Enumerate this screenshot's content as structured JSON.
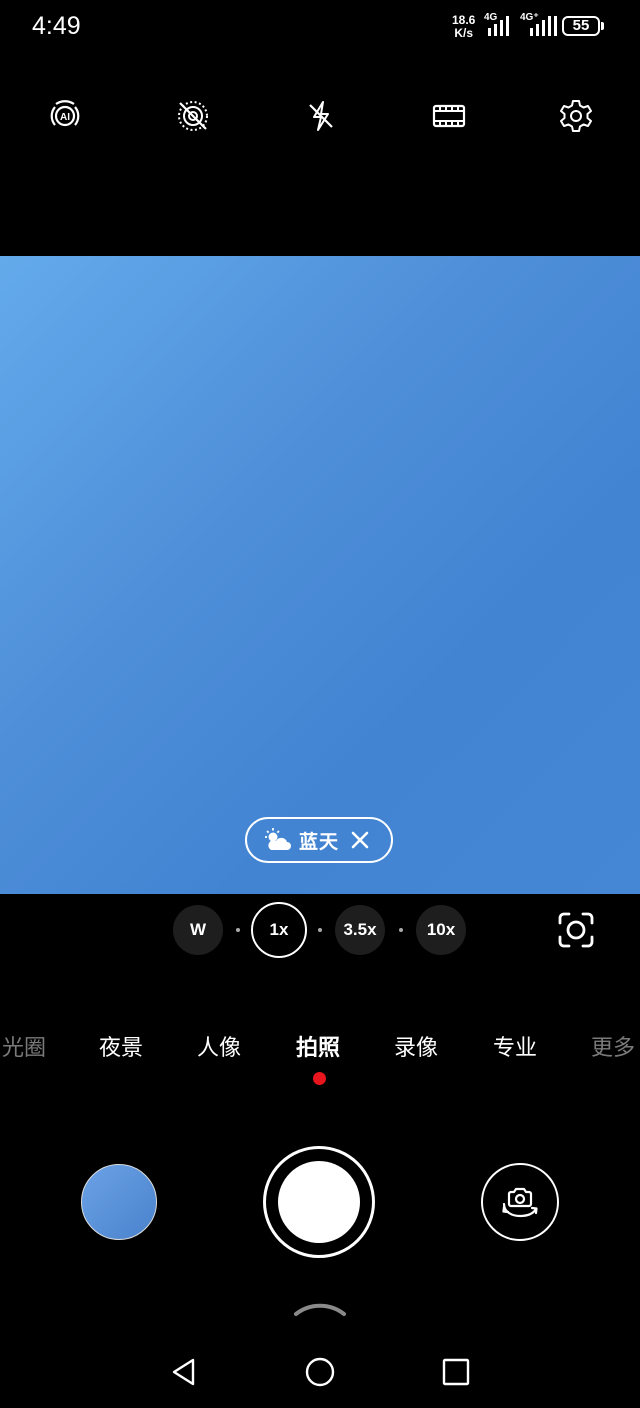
{
  "status": {
    "time": "4:49",
    "net_speed_value": "18.6",
    "net_speed_unit": "K/s",
    "sim1_label": "4G",
    "sim2_label": "4G⁺",
    "battery": "55"
  },
  "toolbar": {
    "icons": [
      "ai-scene-icon",
      "live-photo-off-icon",
      "flash-off-icon",
      "aspect-ratio-icon",
      "settings-icon"
    ]
  },
  "viewfinder": {
    "scene_label": "蓝天",
    "scene_icon": "partly-cloudy-icon"
  },
  "zoom": {
    "options": [
      "W",
      "1x",
      "3.5x",
      "10x"
    ],
    "active": "1x"
  },
  "modes": {
    "items": [
      "光圈",
      "夜景",
      "人像",
      "拍照",
      "录像",
      "专业",
      "更多"
    ],
    "active": "拍照"
  },
  "colors": {
    "sky": "#4a8bd6",
    "mode_indicator": "#e8161c"
  }
}
